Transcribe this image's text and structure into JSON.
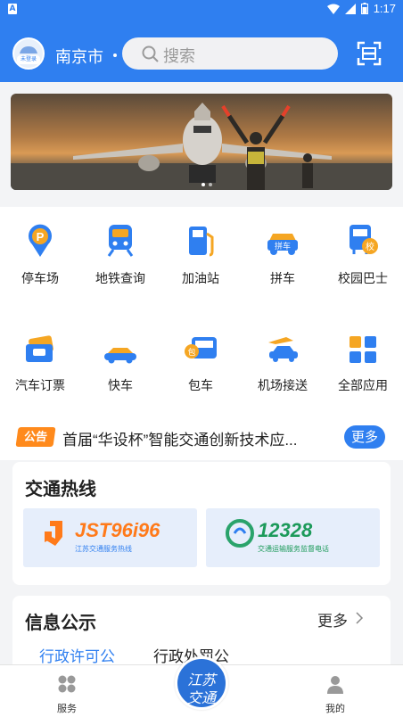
{
  "status_bar": {
    "time": "1:17",
    "app_badge": "A"
  },
  "header": {
    "avatar_tag": "未登录",
    "city": "南京市",
    "search_placeholder": "搜索"
  },
  "services": [
    {
      "label": "停车场",
      "icon": "parking-icon"
    },
    {
      "label": "地铁查询",
      "icon": "metro-icon"
    },
    {
      "label": "加油站",
      "icon": "gas-station-icon"
    },
    {
      "label": "拼车",
      "icon": "carpool-icon"
    },
    {
      "label": "校园巴士",
      "icon": "school-bus-icon"
    },
    {
      "label": "汽车订票",
      "icon": "bus-ticket-icon"
    },
    {
      "label": "快车",
      "icon": "express-car-icon"
    },
    {
      "label": "包车",
      "icon": "charter-bus-icon"
    },
    {
      "label": "机场接送",
      "icon": "airport-transfer-icon"
    },
    {
      "label": "全部应用",
      "icon": "all-apps-icon"
    }
  ],
  "notice": {
    "badge": "公告",
    "text": "首届“华设杯”智能交通创新技术应...",
    "more": "更多"
  },
  "hotline": {
    "title": "交通热线",
    "items": [
      {
        "number": "JST96i96",
        "subtitle": "江苏交通服务热线"
      },
      {
        "number": "12328",
        "subtitle": "交通运输服务监督电话"
      }
    ]
  },
  "info": {
    "title": "信息公示",
    "more": "更多",
    "tabs": [
      "行政许可公",
      "行政处罚公"
    ]
  },
  "bottom_nav": {
    "left": "服务",
    "center_line1": "江苏",
    "center_line2": "交通",
    "right": "我的"
  },
  "colors": {
    "primary": "#2f7ff0",
    "notice_badge": "#ff8a1c",
    "icon_orange": "#f5a623"
  }
}
